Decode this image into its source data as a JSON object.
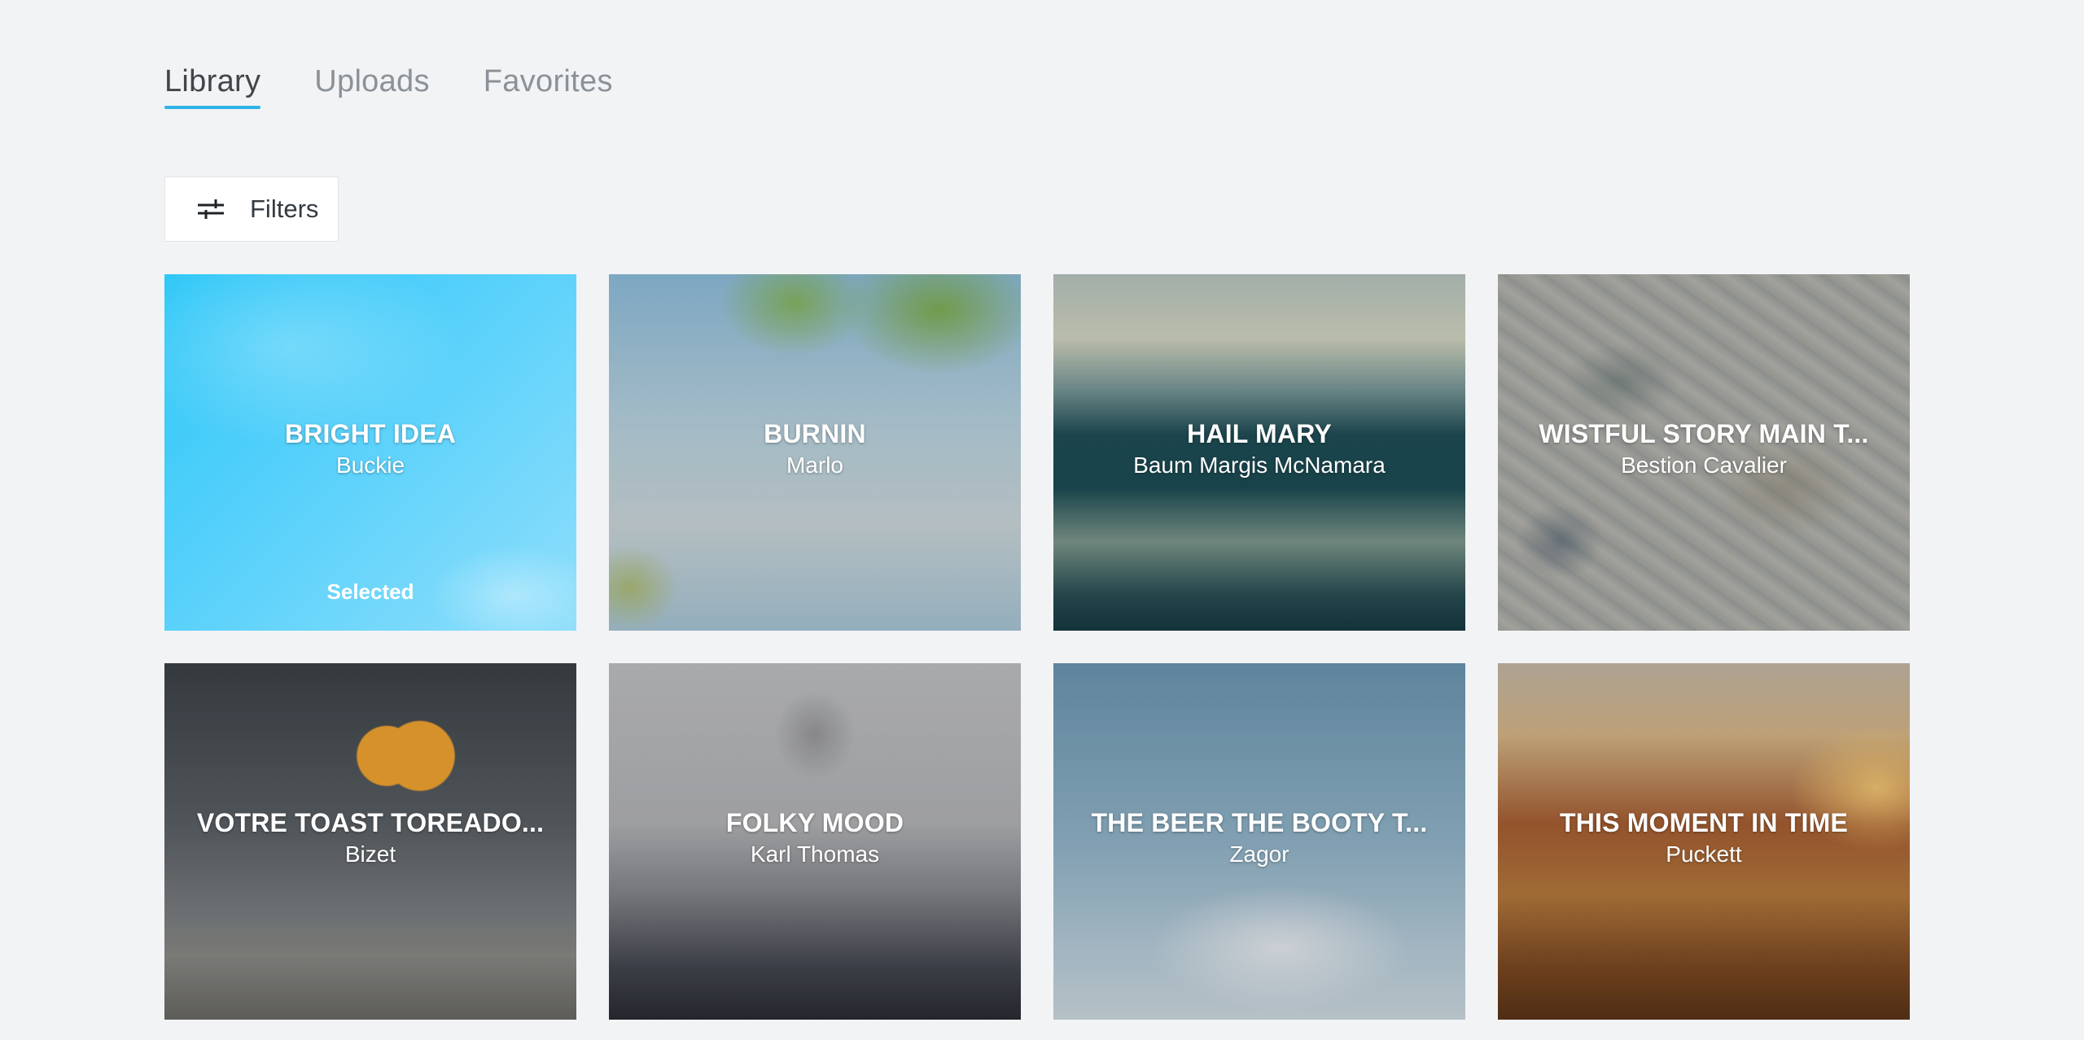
{
  "tabs": [
    {
      "label": "Library",
      "active": true
    },
    {
      "label": "Uploads",
      "active": false
    },
    {
      "label": "Favorites",
      "active": false
    }
  ],
  "filters": {
    "label": "Filters",
    "icon": "sliders-icon"
  },
  "tracks": [
    {
      "title": "BRIGHT IDEA",
      "artist": "Buckie",
      "status": "Selected"
    },
    {
      "title": "BURNIN",
      "artist": "Marlo"
    },
    {
      "title": "HAIL MARY",
      "artist": "Baum Margis McNamara"
    },
    {
      "title": "WISTFUL STORY MAIN T...",
      "artist": "Bestion Cavalier"
    },
    {
      "title": "VOTRE TOAST TOREADO...",
      "artist": "Bizet"
    },
    {
      "title": "FOLKY MOOD",
      "artist": "Karl Thomas"
    },
    {
      "title": "THE BEER THE BOOTY T...",
      "artist": "Zagor"
    },
    {
      "title": "THIS MOMENT IN TIME",
      "artist": "Puckett"
    }
  ],
  "colors": {
    "background": "#f2f3f5",
    "accent": "#2fb3e8",
    "tab_active": "#40464b",
    "tab_inactive": "#8a9298"
  }
}
